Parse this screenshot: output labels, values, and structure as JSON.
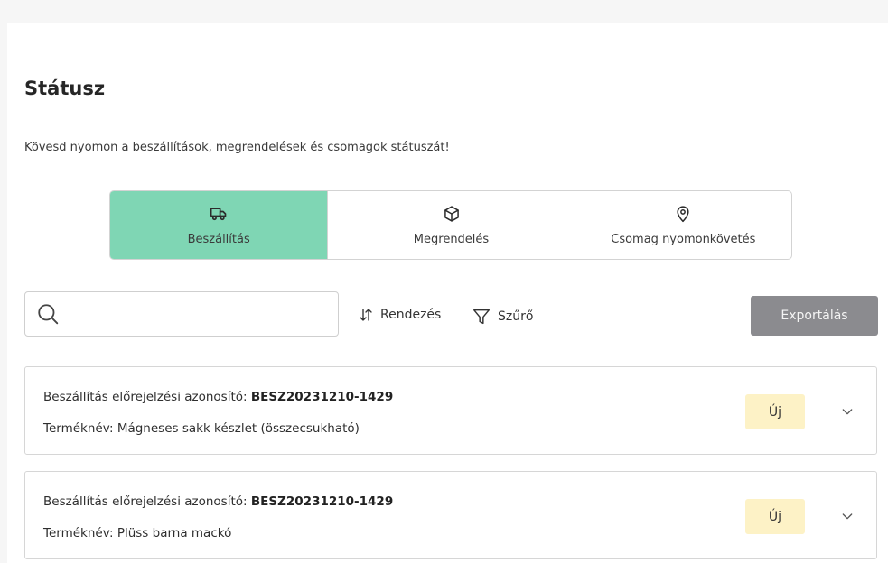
{
  "header": {
    "title": "Státusz",
    "subtitle": "Kövesd nyomon a beszállítások, megrendelések és csomagok státuszát!"
  },
  "tabs": [
    {
      "label": "Beszállítás",
      "icon": "truck-icon",
      "active": true
    },
    {
      "label": "Megrendelés",
      "icon": "box-icon",
      "active": false
    },
    {
      "label": "Csomag nyomonkövetés",
      "icon": "location-pin-icon",
      "active": false
    }
  ],
  "toolbar": {
    "search_placeholder": "",
    "sort_label": "Rendezés",
    "filter_label": "Szűrő",
    "export_label": "Exportálás"
  },
  "list": {
    "items": [
      {
        "id_label": "Beszállítás előrejelzési azonosító:",
        "id_value": "BESZ20231210-1429",
        "product_label": "Terméknév:",
        "product_value": "Mágneses sakk készlet (összecsukható)",
        "status": "Új"
      },
      {
        "id_label": "Beszállítás előrejelzési azonosító:",
        "id_value": "BESZ20231210-1429",
        "product_label": "Terméknév:",
        "product_value": "Plüss barna mackó",
        "status": "Új"
      }
    ]
  },
  "colors": {
    "active_tab": "#7fd6b4",
    "badge_new": "#fdf2c6",
    "export_button": "#8b8b8f"
  }
}
